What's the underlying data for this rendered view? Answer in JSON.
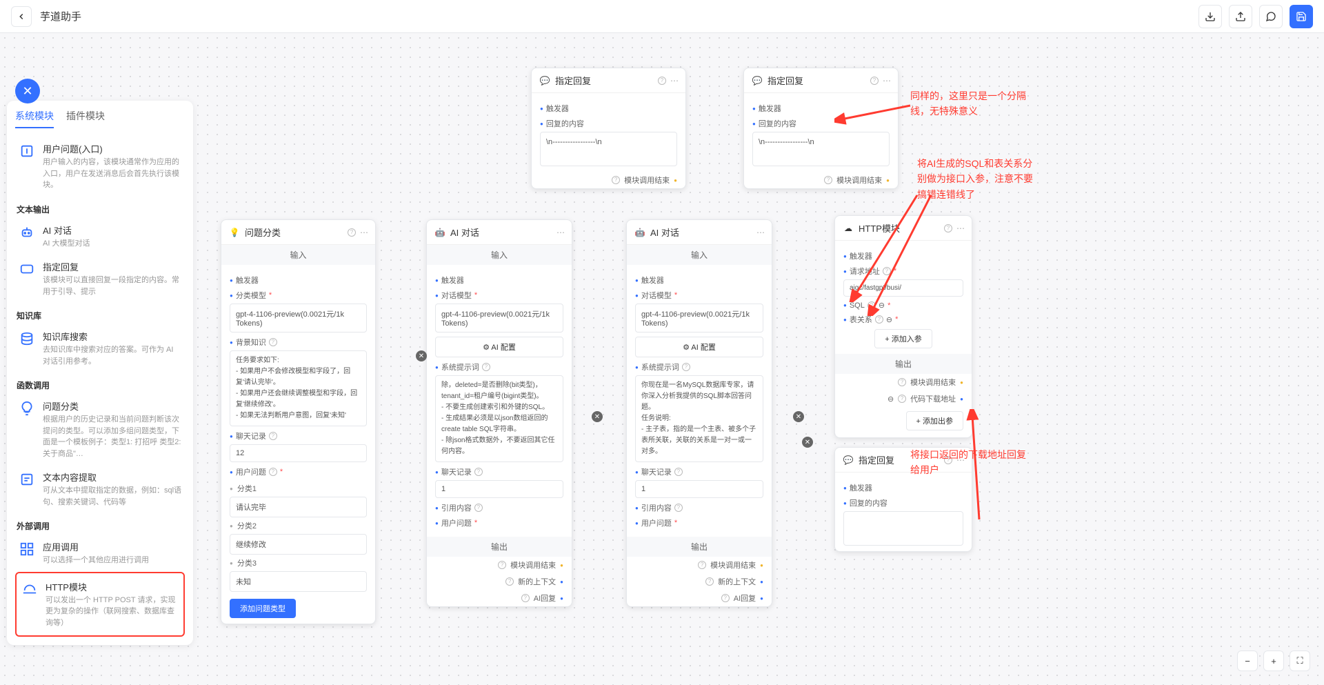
{
  "title": "芋道助手",
  "tabs": {
    "system": "系统模块",
    "plugin": "插件模块"
  },
  "sidebar": {
    "entry": {
      "title": "用户问题(入口)",
      "desc": "用户输入的内容，该模块通常作为应用的入口，用户在发送消息后会首先执行该模块。"
    },
    "group_text": "文本输出",
    "ai_chat": {
      "title": "AI 对话",
      "desc": "AI 大模型对话"
    },
    "reply": {
      "title": "指定回复",
      "desc": "该模块可以直接回复一段指定的内容。常用于引导、提示"
    },
    "group_kb": "知识库",
    "kb_search": {
      "title": "知识库搜索",
      "desc": "去知识库中搜索对应的答案。可作为 AI 对话引用参考。"
    },
    "group_fn": "函数调用",
    "classify": {
      "title": "问题分类",
      "desc": "根据用户的历史记录和当前问题判断该次提问的类型。可以添加多组问题类型，下面是一个模板例子：类型1: 打招呼 类型2: 关于商品\"…"
    },
    "extract": {
      "title": "文本内容提取",
      "desc": "可从文本中提取指定的数据，例如：sql语句、搜索关键词、代码等"
    },
    "group_ext": "外部调用",
    "app_call": {
      "title": "应用调用",
      "desc": "可以选择一个其他应用进行调用"
    },
    "http": {
      "title": "HTTP模块",
      "desc": "可以发出一个 HTTP POST 请求，实现更为复杂的操作（联网搜索、数据库查询等）"
    }
  },
  "nodes": {
    "classify": {
      "title": "问题分类",
      "input": "输入",
      "trigger": "触发器",
      "model_label": "分类模型",
      "model": "gpt-4-1106-preview(0.0021元/1k Tokens)",
      "bg_label": "背景知识",
      "bg_text": "任务要求如下:\n- 如果用户不会修改模型和字段了，回复'请认完毕'。\n- 如果用户还会继续调整模型和字段，回复'继续修改'。\n- 如果无法判断用户意图，回复'未知'",
      "history_label": "聊天记录",
      "history": "12",
      "question_label": "用户问题",
      "cat1_label": "分类1",
      "cat1": "请认完毕",
      "cat2_label": "分类2",
      "cat2": "继续修改",
      "cat3_label": "分类3",
      "cat3": "未知",
      "add_cat": "添加问题类型"
    },
    "ai1": {
      "title": "AI 对话",
      "input": "输入",
      "output": "输出",
      "trigger": "触发器",
      "model_label": "对话模型",
      "model": "gpt-4-1106-preview(0.0021元/1k Tokens)",
      "config": "AI 配置",
      "prompt_label": "系统提示词",
      "prompt": "除，deleted=是否删除(bit类型)，tenant_id=租户编号(bigint类型)。\n- 不要生成创建索引和外键的SQL。\n- 生成结果必须是以json数组返回的create table SQL字符串。\n- 除json格式数据外，不要返回其它任何内容。",
      "history_label": "聊天记录",
      "history": "1",
      "quote_label": "引用内容",
      "question_label": "用户问题",
      "out_end": "模块调用结束",
      "out_ctx": "新的上下文",
      "out_ai": "AI回复"
    },
    "ai2": {
      "title": "AI 对话",
      "input": "输入",
      "output": "输出",
      "trigger": "触发器",
      "model_label": "对话模型",
      "model": "gpt-4-1106-preview(0.0021元/1k Tokens)",
      "config": "AI 配置",
      "prompt_label": "系统提示词",
      "prompt": "你现在是一名MySQL数据库专家，请你深入分析我提供的SQL脚本回答问题。\n任务说明:\n- 主子表，指的是一个主表、被多个子表所关联，关联的关系是一对一或一对多。",
      "history_label": "聊天记录",
      "history": "1",
      "quote_label": "引用内容",
      "question_label": "用户问题",
      "out_end": "模块调用结束",
      "out_ctx": "新的上下文",
      "out_ai": "AI回复"
    },
    "reply1": {
      "title": "指定回复",
      "trigger": "触发器",
      "content_label": "回复的内容",
      "content": "\\n-----------------\\n",
      "out": "模块调用结束"
    },
    "reply2": {
      "title": "指定回复",
      "trigger": "触发器",
      "content_label": "回复的内容",
      "content": "\\n-----------------\\n",
      "out": "模块调用结束"
    },
    "reply3": {
      "title": "指定回复",
      "trigger": "触发器",
      "content_label": "回复的内容"
    },
    "http": {
      "title": "HTTP模块",
      "trigger": "触发器",
      "output": "输出",
      "url_label": "请求地址",
      "url": "                                    aigc/fastgpt/busi/",
      "sql_label": "SQL",
      "rel_label": "表关系",
      "add_in": "+ 添加入参",
      "out_end": "模块调用结束",
      "out_download": "代码下载地址",
      "add_out": "+ 添加出参"
    }
  },
  "annotations": {
    "a1": "同样的，这里只是一个分隔线，无特殊意义",
    "a2": "将AI生成的SQL和表关系分别做为接口入参，注意不要搞错连错线了",
    "a3": "将接口返回的下载地址回复给用户"
  }
}
